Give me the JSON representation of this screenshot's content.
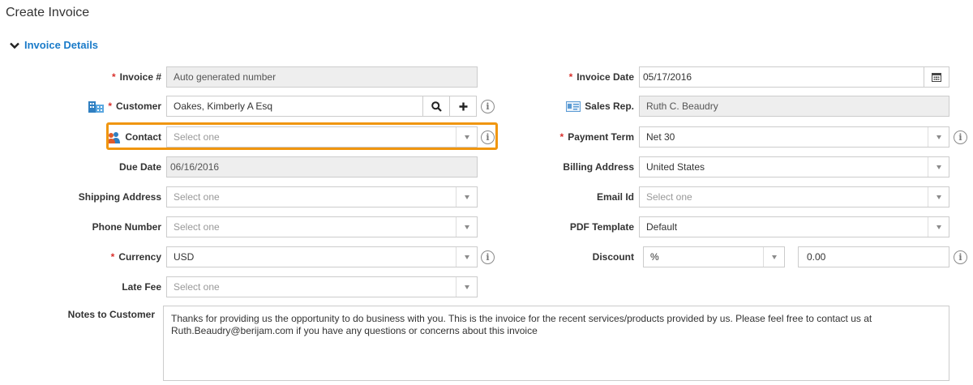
{
  "page": {
    "title": "Create Invoice"
  },
  "section": {
    "title": "Invoice Details",
    "icon": "chevron-down-icon"
  },
  "form": {
    "invoice_number": {
      "label": "Invoice #",
      "value": "Auto generated number"
    },
    "customer": {
      "label": "Customer",
      "value": "Oakes, Kimberly A Esq",
      "icon": "building-icon",
      "search_icon": "search-icon",
      "add_icon": "plus-icon"
    },
    "contact": {
      "label": "Contact",
      "placeholder": "Select one",
      "icon": "contact-people-icon"
    },
    "due_date": {
      "label": "Due Date",
      "value": "06/16/2016"
    },
    "shipping_address": {
      "label": "Shipping Address",
      "placeholder": "Select one"
    },
    "phone_number": {
      "label": "Phone Number",
      "placeholder": "Select one"
    },
    "currency": {
      "label": "Currency",
      "value": "USD"
    },
    "late_fee": {
      "label": "Late Fee",
      "placeholder": "Select one"
    },
    "invoice_date": {
      "label": "Invoice Date",
      "value": "05/17/2016",
      "icon": "calendar-icon"
    },
    "sales_rep": {
      "label": "Sales Rep.",
      "value": "Ruth C. Beaudry",
      "icon": "id-card-icon"
    },
    "payment_term": {
      "label": "Payment Term",
      "value": "Net 30"
    },
    "billing_address": {
      "label": "Billing Address",
      "value": "United States"
    },
    "email_id": {
      "label": "Email Id",
      "placeholder": "Select one"
    },
    "pdf_template": {
      "label": "PDF Template",
      "value": "Default"
    },
    "discount": {
      "label": "Discount",
      "type_value": "%",
      "amount": "0.00"
    },
    "notes": {
      "label": "Notes to Customer",
      "value": "Thanks for providing us the opportunity to do business with you. This is the invoice for the recent services/products provided by us. Please feel free to contact us at Ruth.Beaudry@berijam.com if you have any questions or concerns about this invoice"
    }
  },
  "required_mark": "*",
  "info_glyph": "i",
  "colors": {
    "accent": "#1a7bc9",
    "required": "#d9302c",
    "highlight": "#f0960f"
  }
}
